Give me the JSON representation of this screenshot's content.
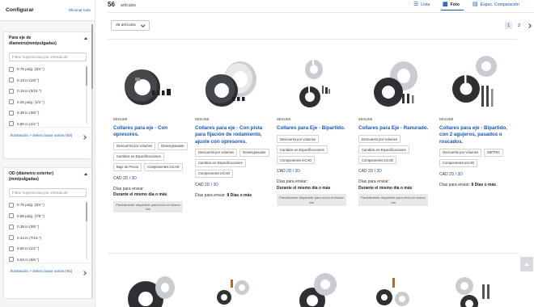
{
  "sidebar": {
    "title": "Configurar",
    "clear_all": "Eliminar todo",
    "panels": [
      {
        "title": "Para eje de diametro(mm/pulgadas)",
        "placeholder": "Filtrar sugerencias por entrada de",
        "options": [
          "0.75 pulg. (3/4 \")",
          "0.13 in (1/8 \")",
          "0.19 in (3/16 \")",
          "0.25 pulg. (1/4 \")",
          "0.38 in (3/8 \")",
          "0.50 in (1/2 \")"
        ],
        "footer": "Ilustración > Seleccionar varios (54)"
      },
      {
        "title": "OD (diámetro exterior) (mm/pulgadas)",
        "placeholder": "Filtrar sugerencias por entrada de",
        "options": [
          "0.75 pulg. (3/4 \")",
          "0.88 pulg. (7/8 \")",
          "0.38 in (3/8 \")",
          "0.44 in (7/16 \")",
          "0.50 in (1/2 \")",
          "0.63 in (5/8 \")"
        ],
        "footer": "Ilustración > Seleccionar varios (91)"
      }
    ]
  },
  "topbar": {
    "count": "56",
    "count_label": "artículos",
    "views": [
      "Lista",
      "Foto",
      "Espec. Comparación"
    ],
    "active_view": "Foto",
    "per_page": "45 artículos",
    "pages": [
      "1",
      "2"
    ],
    "current_page": "1"
  },
  "products": [
    {
      "brand": "MISUMI",
      "name": "Collares para eje - Con opresores.",
      "tags": [
        "Descuento por volumen",
        "Desengrasante",
        "Cambios en Especificaciones",
        "Bajo de Precio",
        "Componentes inCAD"
      ],
      "cad_label": "CAD",
      "cad_2d": "2D",
      "cad_sep": "/",
      "cad_3d": "3D",
      "ship_label": "Días para enviar:",
      "ship_value": "Durante el mismo día o más",
      "notice": "Parcialmente disponible para envío el mismo día"
    },
    {
      "brand": "MISUMI",
      "name": "Collares para eje - Con pista para fijación de rodamiento, ajuste con opresores.",
      "tags": [
        "Descuento por volumen",
        "Desengrasante",
        "Cambios en Especificaciones",
        "Componentes inCAD"
      ],
      "cad_label": "CAD",
      "cad_2d": "2D",
      "cad_sep": "/",
      "cad_3d": "3D",
      "ship_label": "Días para enviar:",
      "ship_value": "8 Días o más",
      "notice": ""
    },
    {
      "brand": "MISUMI",
      "name": "Collares para Eje - Bipartido.",
      "tags": [
        "Descuento por volumen",
        "Cambios en Especificaciones",
        "Componentes inCAD"
      ],
      "cad_label": "CAD",
      "cad_2d": "2D",
      "cad_sep": "/",
      "cad_3d": "3D",
      "ship_label": "Días para enviar:",
      "ship_value": "Durante el mismo día o más",
      "notice": "Parcialmente disponible para envío el mismo día"
    },
    {
      "brand": "MISUMI",
      "name": "Collares para Eje - Ranurado.",
      "tags": [
        "Descuento por volumen",
        "Cambios en Especificaciones",
        "Componentes inCAD"
      ],
      "cad_label": "CAD",
      "cad_2d": "2D",
      "cad_sep": "/",
      "cad_3d": "3D",
      "ship_label": "Días para enviar:",
      "ship_value": "Durante el mismo día o más",
      "notice": "Parcialmente disponible para envío el mismo día"
    },
    {
      "brand": "MISUMI",
      "name": "Collares para eje - Bipartido, con 2 agujeros, pasados o roscados.",
      "tags": [
        "Descuento por volumen",
        "METRIC",
        "Componentes inCAD"
      ],
      "cad_label": "CAD",
      "cad_2d": "2D",
      "cad_sep": "/",
      "cad_3d": "3D",
      "ship_label": "Días para enviar:",
      "ship_value": "8 Días o más",
      "notice": ""
    }
  ],
  "colors": {
    "link": "#1a56b8",
    "sidebar_bg": "#f4f5f7",
    "notice_bg": "#e8e9eb",
    "metal_dark": "#2e3034",
    "metal_light": "#c9ccd0"
  }
}
